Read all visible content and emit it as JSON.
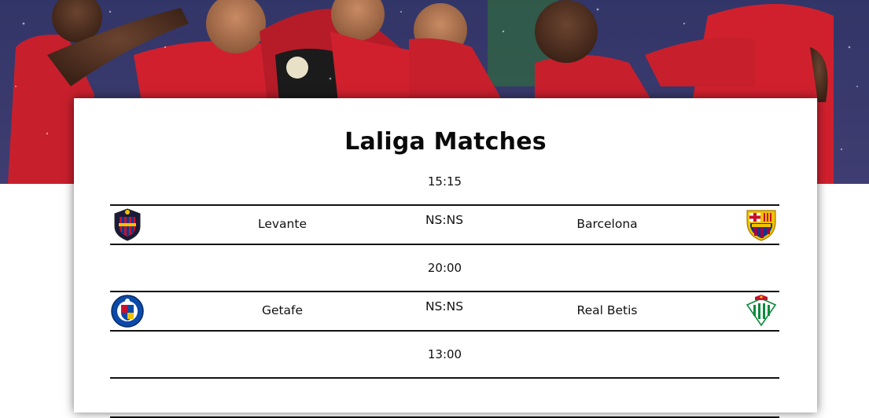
{
  "page": {
    "title": "Laliga Matches"
  },
  "matches": [
    {
      "time": "15:15",
      "home": {
        "name": "Levante",
        "crest": "levante-crest-icon"
      },
      "score": "NS:NS",
      "away": {
        "name": "Barcelona",
        "crest": "barcelona-crest-icon"
      }
    },
    {
      "time": "20:00",
      "home": {
        "name": "Getafe",
        "crest": "getafe-crest-icon"
      },
      "score": "NS:NS",
      "away": {
        "name": "Real Betis",
        "crest": "real-betis-crest-icon"
      }
    },
    {
      "time": "13:00"
    }
  ],
  "colors": {
    "hero_red": "#d0202e",
    "hero_night": "#1c2350",
    "text": "#111111"
  }
}
